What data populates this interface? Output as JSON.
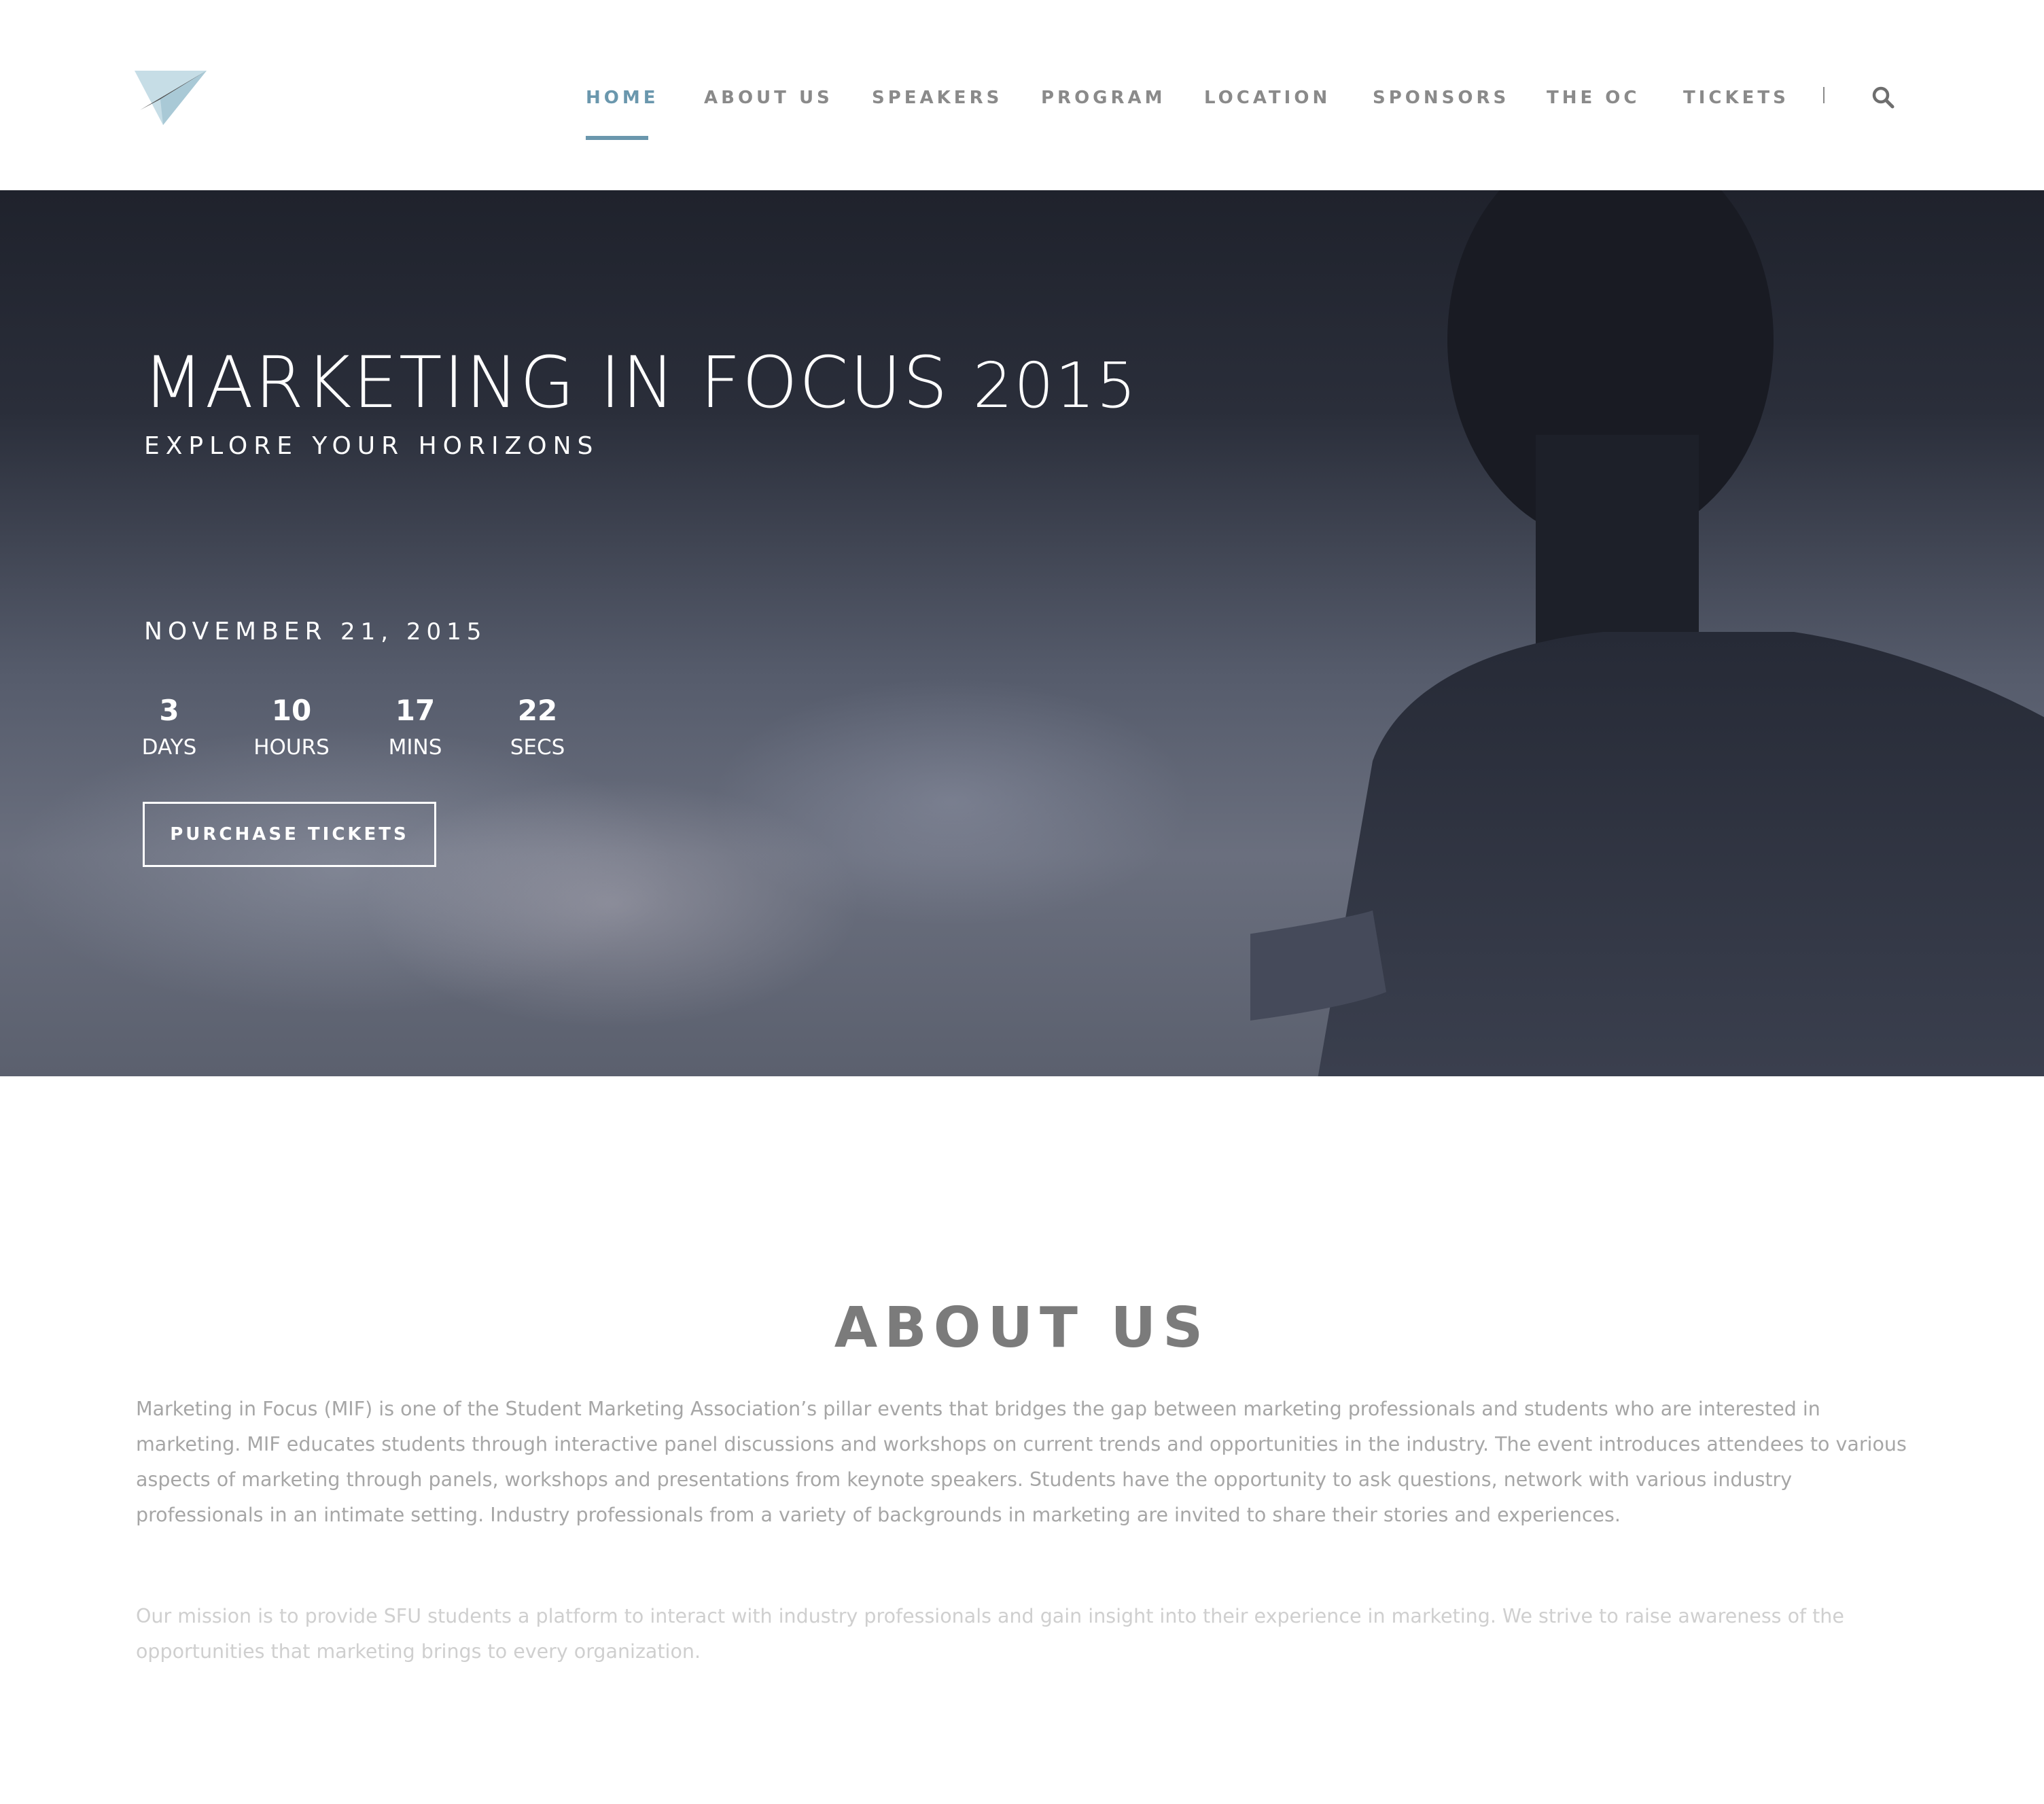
{
  "colors": {
    "accent": "#6a97ad",
    "nav_text": "#8a8a8a",
    "hero_text": "#ffffff",
    "about_title": "#7b7b7b",
    "about_body": "#a6a6a6",
    "about_body_faded": "#cfcfcf"
  },
  "header": {
    "logo_icon": "paper-plane-icon",
    "search_icon": "magnifier-icon",
    "nav": [
      {
        "label": "HOME",
        "active": true
      },
      {
        "label": "ABOUT US"
      },
      {
        "label": "SPEAKERS"
      },
      {
        "label": "PROGRAM"
      },
      {
        "label": "LOCATION"
      },
      {
        "label": "SPONSORS"
      },
      {
        "label": "THE OC"
      },
      {
        "label": "TICKETS"
      }
    ]
  },
  "hero": {
    "title_main": "MARKETING IN FOCUS",
    "title_year": "2015",
    "subtitle": "EXPLORE YOUR HORIZONS",
    "date_month": "NOVEMBER",
    "date_rest": "21, 2015",
    "countdown": [
      {
        "value": "3",
        "label": "DAYS"
      },
      {
        "value": "10",
        "label": "HOURS"
      },
      {
        "value": "17",
        "label": "MINS"
      },
      {
        "value": "22",
        "label": "SECS"
      }
    ],
    "cta_label": "PURCHASE TICKETS"
  },
  "about": {
    "title": "ABOUT US",
    "paragraph1": "Marketing in Focus (MIF) is one of the Student Marketing Association’s pillar events that bridges the gap between marketing professionals and students who are interested in marketing. MIF educates students through interactive panel discussions and workshops on current trends and opportunities in the industry. The event introduces attendees to various aspects of marketing through panels, workshops and presentations from keynote speakers. Students have the opportunity to ask questions, network with various industry professionals in an intimate setting. Industry professionals from a variety of backgrounds in marketing are invited to share their stories and experiences.",
    "paragraph2": "Our mission is to provide SFU students a platform to interact with industry professionals and gain insight into their experience in marketing. We strive to raise awareness of the opportunities that marketing brings to every organization."
  }
}
